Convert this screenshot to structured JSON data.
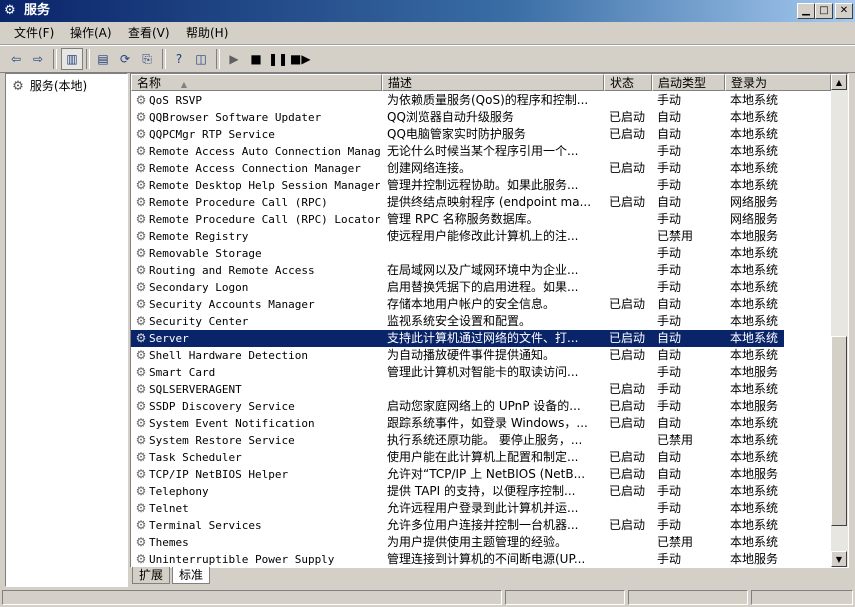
{
  "window": {
    "title": "服务"
  },
  "menu": [
    {
      "label": "文件(F)"
    },
    {
      "label": "操作(A)"
    },
    {
      "label": "查看(V)"
    },
    {
      "label": "帮助(H)"
    }
  ],
  "tree": {
    "root_label": "服务(本地)"
  },
  "columns": {
    "name": "名称",
    "desc": "描述",
    "status": "状态",
    "startup": "启动类型",
    "logon": "登录为"
  },
  "services": [
    {
      "name": "QoS RSVP",
      "desc": "为依赖质量服务(QoS)的程序和控制...",
      "status": "",
      "startup": "手动",
      "logon": "本地系统"
    },
    {
      "name": "QQBrowser Software Updater",
      "desc": "QQ浏览器自动升级服务",
      "status": "已启动",
      "startup": "自动",
      "logon": "本地系统"
    },
    {
      "name": "QQPCMgr RTP Service",
      "desc": "QQ电脑管家实时防护服务",
      "status": "已启动",
      "startup": "自动",
      "logon": "本地系统"
    },
    {
      "name": "Remote Access Auto Connection Manager",
      "desc": "无论什么时候当某个程序引用一个...",
      "status": "",
      "startup": "手动",
      "logon": "本地系统"
    },
    {
      "name": "Remote Access Connection Manager",
      "desc": "创建网络连接。",
      "status": "已启动",
      "startup": "手动",
      "logon": "本地系统"
    },
    {
      "name": "Remote Desktop Help Session Manager",
      "desc": "管理并控制远程协助。如果此服务...",
      "status": "",
      "startup": "手动",
      "logon": "本地系统"
    },
    {
      "name": "Remote Procedure Call (RPC)",
      "desc": "提供终结点映射程序 (endpoint ma...",
      "status": "已启动",
      "startup": "自动",
      "logon": "网络服务"
    },
    {
      "name": "Remote Procedure Call (RPC) Locator",
      "desc": "管理 RPC 名称服务数据库。",
      "status": "",
      "startup": "手动",
      "logon": "网络服务"
    },
    {
      "name": "Remote Registry",
      "desc": "使远程用户能修改此计算机上的注...",
      "status": "",
      "startup": "已禁用",
      "logon": "本地服务"
    },
    {
      "name": "Removable Storage",
      "desc": "",
      "status": "",
      "startup": "手动",
      "logon": "本地系统"
    },
    {
      "name": "Routing and Remote Access",
      "desc": "在局域网以及广域网环境中为企业...",
      "status": "",
      "startup": "手动",
      "logon": "本地系统"
    },
    {
      "name": "Secondary Logon",
      "desc": "启用替换凭据下的启用进程。如果...",
      "status": "",
      "startup": "手动",
      "logon": "本地系统"
    },
    {
      "name": "Security Accounts Manager",
      "desc": "存储本地用户帐户的安全信息。",
      "status": "已启动",
      "startup": "自动",
      "logon": "本地系统"
    },
    {
      "name": "Security Center",
      "desc": "监视系统安全设置和配置。",
      "status": "",
      "startup": "手动",
      "logon": "本地系统"
    },
    {
      "name": "Server",
      "desc": "支持此计算机通过网络的文件、打...",
      "status": "已启动",
      "startup": "自动",
      "logon": "本地系统",
      "selected": true
    },
    {
      "name": "Shell Hardware Detection",
      "desc": "为自动播放硬件事件提供通知。",
      "status": "已启动",
      "startup": "自动",
      "logon": "本地系统"
    },
    {
      "name": "Smart Card",
      "desc": "管理此计算机对智能卡的取读访问...",
      "status": "",
      "startup": "手动",
      "logon": "本地服务"
    },
    {
      "name": "SQLSERVERAGENT",
      "desc": "",
      "status": "已启动",
      "startup": "手动",
      "logon": "本地系统"
    },
    {
      "name": "SSDP Discovery Service",
      "desc": "启动您家庭网络上的 UPnP 设备的...",
      "status": "已启动",
      "startup": "手动",
      "logon": "本地服务"
    },
    {
      "name": "System Event Notification",
      "desc": "跟踪系统事件，如登录 Windows，...",
      "status": "已启动",
      "startup": "自动",
      "logon": "本地系统"
    },
    {
      "name": "System Restore Service",
      "desc": "执行系统还原功能。 要停止服务，...",
      "status": "",
      "startup": "已禁用",
      "logon": "本地系统"
    },
    {
      "name": "Task Scheduler",
      "desc": "使用户能在此计算机上配置和制定...",
      "status": "已启动",
      "startup": "自动",
      "logon": "本地系统"
    },
    {
      "name": "TCP/IP NetBIOS Helper",
      "desc": "允许对“TCP/IP 上 NetBIOS (NetB...",
      "status": "已启动",
      "startup": "自动",
      "logon": "本地服务"
    },
    {
      "name": "Telephony",
      "desc": "提供 TAPI 的支持，以便程序控制...",
      "status": "已启动",
      "startup": "手动",
      "logon": "本地系统"
    },
    {
      "name": "Telnet",
      "desc": "允许远程用户登录到此计算机并运...",
      "status": "",
      "startup": "手动",
      "logon": "本地系统"
    },
    {
      "name": "Terminal Services",
      "desc": "允许多位用户连接并控制一台机器...",
      "status": "已启动",
      "startup": "手动",
      "logon": "本地系统"
    },
    {
      "name": "Themes",
      "desc": "为用户提供使用主题管理的经验。",
      "status": "",
      "startup": "已禁用",
      "logon": "本地系统"
    },
    {
      "name": "Uninterruptible Power Supply",
      "desc": "管理连接到计算机的不间断电源(UP...",
      "status": "",
      "startup": "手动",
      "logon": "本地服务"
    }
  ],
  "tabs": [
    {
      "label": "扩展"
    },
    {
      "label": "标准",
      "active": true
    }
  ]
}
